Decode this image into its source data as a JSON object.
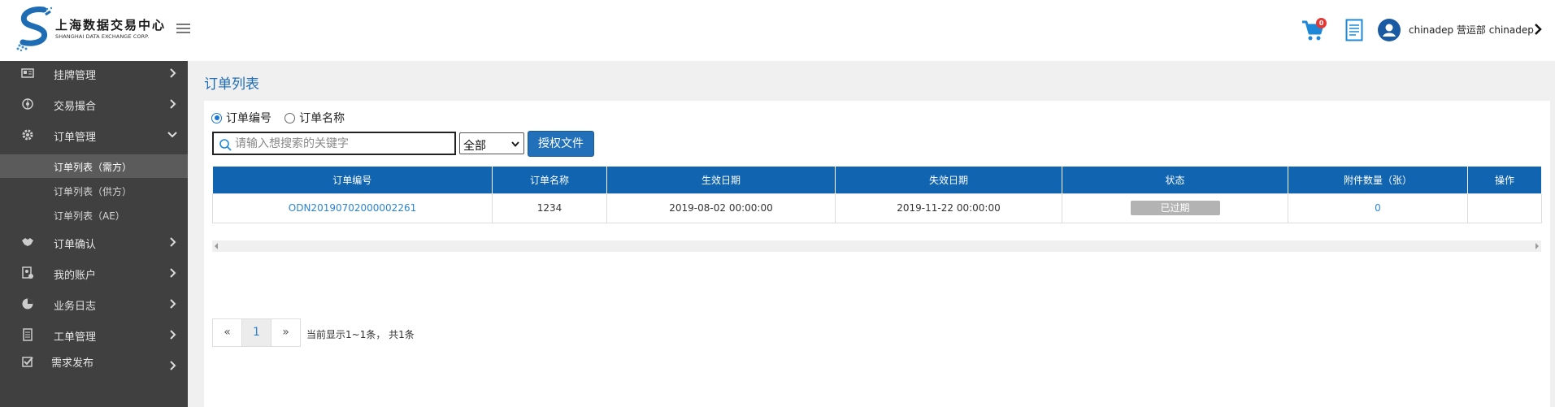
{
  "header": {
    "logo_cn": "上海数据交易中心",
    "logo_en": "SHANGHAI DATA EXCHANGE CORP.",
    "cart_count": "0",
    "username": "chinadep 营运部 chinadep"
  },
  "sidebar": {
    "items": [
      {
        "label": "挂牌管理",
        "icon": "listing-icon"
      },
      {
        "label": "交易撮合",
        "icon": "match-icon"
      },
      {
        "label": "订单管理",
        "icon": "gear-icon",
        "expanded": true
      },
      {
        "label": "订单确认",
        "icon": "handshake-icon"
      },
      {
        "label": "我的账户",
        "icon": "account-icon"
      },
      {
        "label": "业务日志",
        "icon": "pie-icon"
      },
      {
        "label": "工单管理",
        "icon": "document-icon"
      },
      {
        "label": "需求发布",
        "icon": "check-icon"
      }
    ],
    "sub_items": [
      {
        "label": "订单列表（需方）",
        "active": true
      },
      {
        "label": "订单列表（供方）",
        "active": false
      },
      {
        "label": "订单列表（AE）",
        "active": false
      }
    ]
  },
  "main": {
    "title": "订单列表",
    "radio_options": [
      {
        "label": "订单编号",
        "checked": true
      },
      {
        "label": "订单名称",
        "checked": false
      }
    ],
    "search_placeholder": "请输入想搜索的关键字",
    "filter_selected": "全部",
    "auth_button": "授权文件",
    "table": {
      "columns": [
        "订单编号",
        "订单名称",
        "生效日期",
        "失效日期",
        "状态",
        "附件数量（张）",
        "操作"
      ],
      "rows": [
        {
          "order_no": "ODN20190702000002261",
          "order_name": "1234",
          "start_date": "2019-08-02 00:00:00",
          "end_date": "2019-11-22 00:00:00",
          "status": "已过期",
          "attachments": "0",
          "action": ""
        }
      ]
    },
    "pagination": {
      "prev": "«",
      "current": "1",
      "next": "»",
      "info": "当前显示1~1条， 共1条"
    }
  },
  "colors": {
    "accent": "#1064b0",
    "sidebar_bg": "#404040",
    "link": "#2a84d6",
    "badge": "#e53935"
  }
}
